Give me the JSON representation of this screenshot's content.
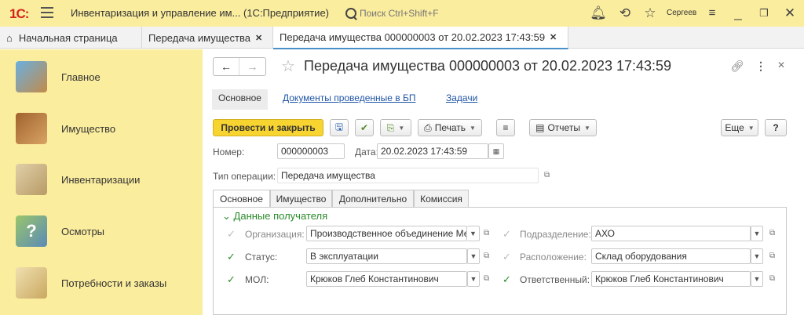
{
  "titlebar": {
    "logo": "1С:",
    "app_title": "Инвентаризация и управление им...  (1С:Предприятие)",
    "search_placeholder": "Поиск Ctrl+Shift+F",
    "user": "Сергеев"
  },
  "tabs": [
    {
      "label": "Начальная страница"
    },
    {
      "label": "Передача имущества"
    },
    {
      "label": "Передача имущества 000000003 от 20.02.2023 17:43:59"
    }
  ],
  "sidebar": {
    "items": [
      {
        "label": "Главное",
        "icon": "desk-icon"
      },
      {
        "label": "Имущество",
        "icon": "boxes-icon"
      },
      {
        "label": "Инвентаризации",
        "icon": "folder-icon"
      },
      {
        "label": "Осмотры",
        "icon": "clipboard-question-icon"
      },
      {
        "label": "Потребности и заказы",
        "icon": "bag-icon"
      }
    ]
  },
  "document": {
    "title": "Передача имущества 000000003 от 20.02.2023 17:43:59",
    "subnav": {
      "main": "Основное",
      "docs": "Документы проведенные в БП",
      "tasks": "Задачи"
    },
    "toolbar": {
      "post_close": "Провести и закрыть",
      "print": "Печать",
      "reports": "Отчеты",
      "more": "Еще",
      "help": "?"
    },
    "fields": {
      "number_label": "Номер:",
      "number": "000000003",
      "date_label": "Дата:",
      "date": "20.02.2023 17:43:59",
      "op_type_label": "Тип операции:",
      "op_type": "Передача имущества"
    },
    "form_tabs": [
      "Основное",
      "Имущество",
      "Дополнительно",
      "Комиссия"
    ],
    "recipient": {
      "group_title": "Данные получателя",
      "org_label": "Организация:",
      "org": "Производственное объединение Ме,",
      "status_label": "Статус:",
      "status": "В эксплуатации",
      "mol_label": "МОЛ:",
      "mol": "Крюков Глеб Константинович",
      "dept_label": "Подразделение:",
      "dept": "АХО",
      "location_label": "Расположение:",
      "location": "Склад оборудования",
      "responsible_label": "Ответственный:",
      "responsible": "Крюков Глеб Константинович"
    }
  }
}
